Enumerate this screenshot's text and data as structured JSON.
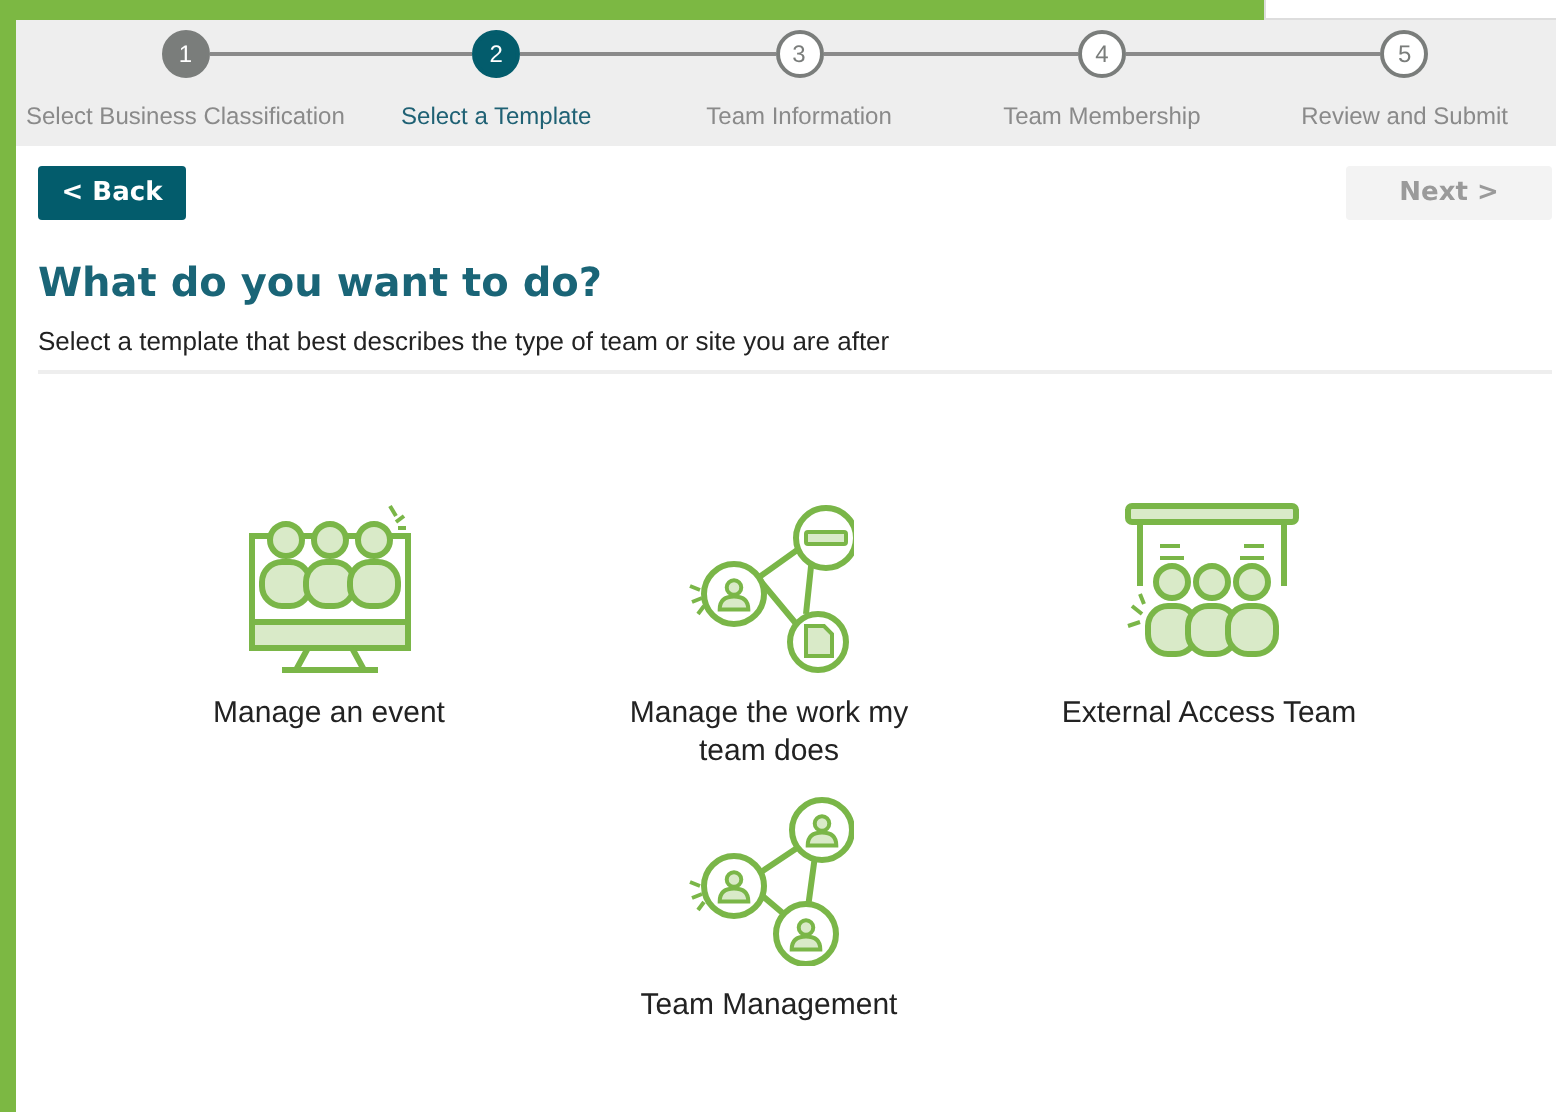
{
  "steps": [
    {
      "number": "1",
      "label": "Select Business Classification",
      "completed": true,
      "selected": false
    },
    {
      "number": "2",
      "label": "Select a Template",
      "completed": false,
      "selected": true
    },
    {
      "number": "3",
      "label": "Team Information",
      "completed": false,
      "selected": false
    },
    {
      "number": "4",
      "label": "Team Membership",
      "completed": false,
      "selected": false
    },
    {
      "number": "5",
      "label": "Review and Submit",
      "completed": false,
      "selected": false
    }
  ],
  "navigation": {
    "back": {
      "label": "< Back",
      "disabled": false
    },
    "next": {
      "label": "Next >",
      "disabled": true
    }
  },
  "heading": "What do you want to do?",
  "subtitle": "Select a template that best describes the type of team or site you are after",
  "templates": [
    {
      "label": "Manage an event",
      "kind": "event"
    },
    {
      "label": "Manage the work my team does",
      "kind": "work"
    },
    {
      "label": "External Access Team",
      "kind": "external"
    },
    {
      "label": "Team Management",
      "kind": "management"
    }
  ]
}
